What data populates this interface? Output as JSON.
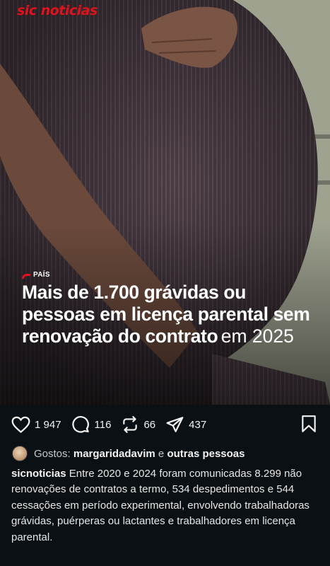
{
  "brand": {
    "name": "sic noticias"
  },
  "post": {
    "section": "PAÍS",
    "headline_bold": "Mais de 1.700 grávidas ou pessoas em licença parental sem renovação do contrato",
    "headline_light": "em 2025"
  },
  "actions": {
    "likes": "1 947",
    "comments": "116",
    "reposts": "66",
    "shares": "437"
  },
  "likes": {
    "prefix": "Gostos:",
    "user": "margaridadavim",
    "connector": "e",
    "others": "outras pessoas"
  },
  "caption": {
    "username": "sicnoticias",
    "text": "Entre 2020 e 2024 foram comunicadas 8.299 não renovações de contratos a termo, 534 despedimentos e 544 cessações em período experimental, envolvendo trabalhadoras grávidas, puérperas ou lactantes e trabalhadores em licença parental."
  },
  "colors": {
    "background": "#0b1014",
    "brand": "#e0121b",
    "dress": "#4d3f48"
  },
  "icons": [
    "heart-icon",
    "comment-icon",
    "repost-icon",
    "share-icon",
    "bookmark-icon"
  ]
}
